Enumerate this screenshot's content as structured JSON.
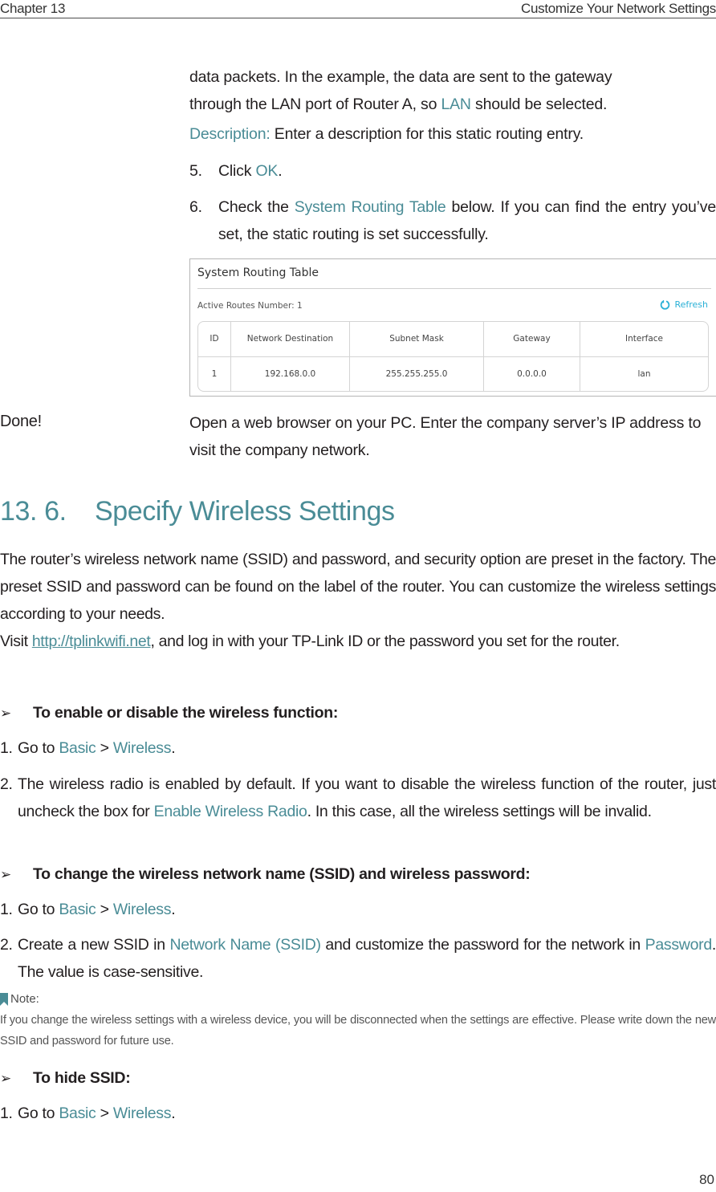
{
  "header": {
    "chapter": "Chapter 13",
    "title": "Customize Your Network Settings"
  },
  "upper": {
    "para1": {
      "line1": "data packets. In the example, the data are sent to the gateway",
      "line2_pre": "through the LAN port of Router A, so ",
      "line2_accent": "LAN",
      "line2_post": " should be selected."
    },
    "description": {
      "label": "Description:",
      "text": " Enter a description for this static routing entry."
    },
    "step5": {
      "num": "5.",
      "pre": "Click ",
      "accent": "OK",
      "post": "."
    },
    "step6": {
      "num": "6.",
      "pre": "Check the ",
      "accent": "System Routing Table",
      "post": " below. If you can find the entry you’ve set, the static routing is set successfully."
    }
  },
  "routing_table": {
    "title": "System Routing Table",
    "active_routes_label": "Active Routes Number:  1",
    "refresh_label": "Refresh",
    "refresh_icon": "refresh-icon",
    "columns": [
      "ID",
      "Network Destination",
      "Subnet Mask",
      "Gateway",
      "Interface"
    ],
    "rows": [
      [
        "1",
        "192.168.0.0",
        "255.255.255.0",
        "0.0.0.0",
        "lan"
      ]
    ]
  },
  "done": {
    "label": "Done!",
    "text": "Open a web browser on your PC. Enter the company server’s IP address to visit the company network."
  },
  "section": {
    "number": "13. 6.",
    "title": "Specify Wireless Settings",
    "intro": "The router’s wireless network name (SSID) and password, and security option are preset in the factory. The preset SSID and password can be found on the label of the router. You can customize the wireless settings according to your needs.",
    "visit_pre": "Visit ",
    "visit_link": "http://tplinkwifi.net",
    "visit_post": ", and log in with your TP-Link ID or the password you set for the router."
  },
  "tasks": [
    {
      "heading": "To enable or disable the wireless function:",
      "steps": [
        {
          "num": "1.",
          "pre": "Go to ",
          "a1": "Basic",
          "mid": " > ",
          "a2": "Wireless",
          "post": "."
        },
        {
          "num": "2.",
          "pre": "The wireless radio is enabled by default. If you want to disable the wireless function of the router, just uncheck the box for ",
          "a1": "Enable Wireless Radio",
          "post": ". In this case, all the wireless settings will be invalid."
        }
      ]
    },
    {
      "heading": "To change the wireless network name (SSID) and wireless password:",
      "steps": [
        {
          "num": "1.",
          "pre": "Go to ",
          "a1": "Basic",
          "mid": " > ",
          "a2": "Wireless",
          "post": "."
        },
        {
          "num": "2.",
          "pre": "Create a new SSID in ",
          "a1": "Network Name (SSID)",
          "mid": " and customize the password for the network in ",
          "a2": "Password",
          "post": ".  The value is case-sensitive."
        }
      ]
    },
    {
      "heading": "To hide SSID:",
      "steps": [
        {
          "num": "1.",
          "pre": "Go to ",
          "a1": "Basic",
          "mid": " > ",
          "a2": "Wireless",
          "post": "."
        }
      ]
    }
  ],
  "arrow_glyph": "➢",
  "note": {
    "label": "Note:",
    "text": "If you change the wireless settings with a wireless device, you will be disconnected when the settings are effective. Please write down the new SSID and password for future use."
  },
  "page_number": "80",
  "colors": {
    "accent": "#4a8c96",
    "refresh": "#2ab0d6",
    "text": "#231f20"
  }
}
